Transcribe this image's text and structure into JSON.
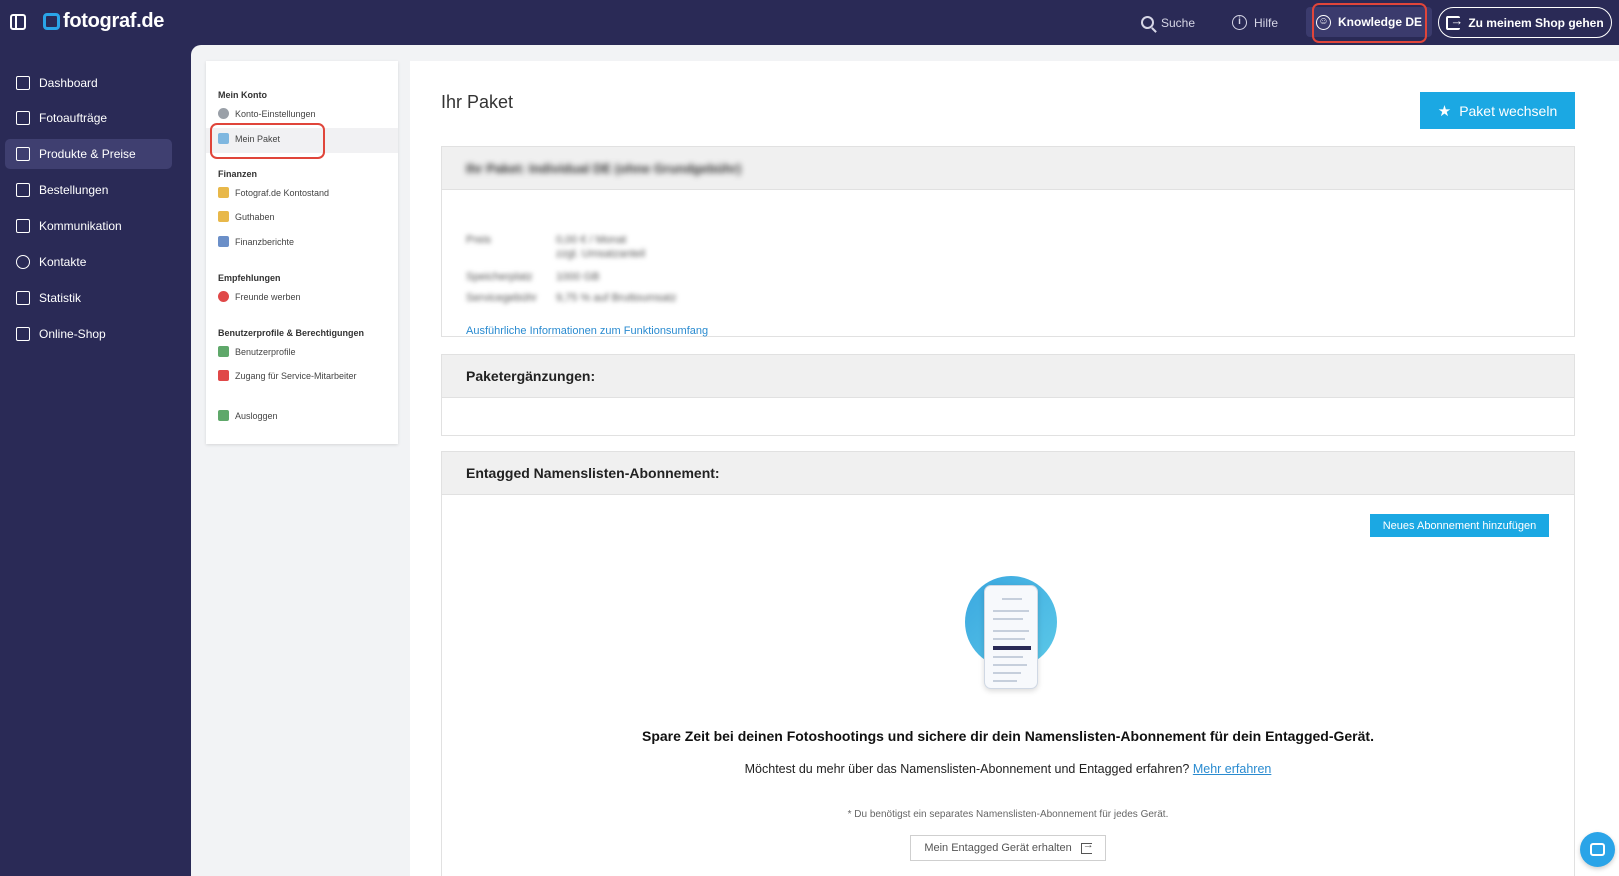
{
  "topbar": {
    "logo": "fotograf.de",
    "search_label": "Suche",
    "help_label": "Hilfe",
    "knowledge_label": "Knowledge DE",
    "shop_label": "Zu meinem Shop gehen"
  },
  "nav": {
    "items": [
      {
        "label": "Dashboard",
        "icon": "home-icon"
      },
      {
        "label": "Fotoaufträge",
        "icon": "image-icon"
      },
      {
        "label": "Produkte & Preise",
        "icon": "cart-icon",
        "active": true
      },
      {
        "label": "Bestellungen",
        "icon": "inbox-icon"
      },
      {
        "label": "Kommunikation",
        "icon": "message-icon"
      },
      {
        "label": "Kontakte",
        "icon": "user-icon"
      },
      {
        "label": "Statistik",
        "icon": "chart-icon"
      },
      {
        "label": "Online-Shop",
        "icon": "store-icon"
      }
    ]
  },
  "subnav": {
    "sections": [
      {
        "title": "Mein Konto",
        "items": [
          {
            "label": "Konto-Einstellungen",
            "color": "#9aa0a8"
          },
          {
            "label": "Mein Paket",
            "color": "#7fb7e0",
            "active": true
          }
        ]
      },
      {
        "title": "Finanzen",
        "items": [
          {
            "label": "Fotograf.de Kontostand",
            "color": "#e8b84a"
          },
          {
            "label": "Guthaben",
            "color": "#e8b84a"
          },
          {
            "label": "Finanzberichte",
            "color": "#6b8fc8"
          }
        ]
      },
      {
        "title": "Empfehlungen",
        "items": [
          {
            "label": "Freunde werben",
            "color": "#e04848"
          }
        ]
      },
      {
        "title": "Benutzerprofile & Berechtigungen",
        "items": [
          {
            "label": "Benutzerprofile",
            "color": "#5fa86a"
          },
          {
            "label": "Zugang für Service-Mitarbeiter",
            "color": "#e04848"
          }
        ]
      }
    ],
    "logout_label": "Ausloggen"
  },
  "main": {
    "title": "Ihr Paket",
    "change_button": "Paket wechseln",
    "package": {
      "header": "Ihr Paket: Individual DE (ohne Grundgebühr)",
      "rows": [
        {
          "label": "Preis",
          "value": "0,00 € / Monat"
        },
        {
          "label": "",
          "value": "zzgl. Umsatzanteil"
        },
        {
          "label": "Speicherplatz",
          "value": "1000 GB"
        },
        {
          "label": "Servicegebühr",
          "value": "9,75 % auf Bruttoumsatz"
        }
      ],
      "info_link": "Ausführliche Informationen zum Funktionsumfang"
    },
    "addons_header": "Paketergänzungen:",
    "entagged": {
      "header": "Entagged Namenslisten-Abonnement:",
      "add_button": "Neues Abonnement hinzufügen",
      "promo_title": "Spare Zeit bei deinen Fotoshootings und sichere dir dein Namenslisten-Abonnement für dein Entagged-Gerät.",
      "promo_text": "Möchtest du mehr über das Namenslisten-Abonnement und Entagged erfahren?",
      "promo_link": "Mehr erfahren",
      "note": "* Du benötigst ein separates Namenslisten-Abonnement für jedes Gerät.",
      "device_button": "Mein Entagged Gerät erhalten"
    }
  },
  "colors": {
    "accent": "#1ba8e3",
    "nav_bg": "#2a2a56",
    "highlight": "#e0453a"
  }
}
